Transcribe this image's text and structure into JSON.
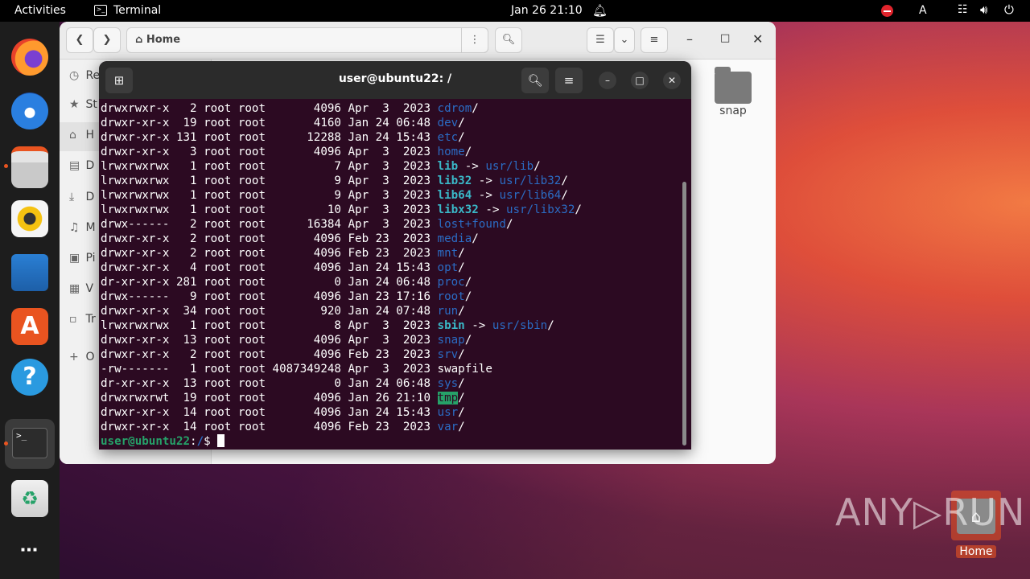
{
  "topbar": {
    "activities": "Activities",
    "app_name": "Terminal",
    "clock": "Jan 26  21:10",
    "keyboard": "A"
  },
  "dock": {
    "items": [
      "Firefox",
      "Thunderbird",
      "Files",
      "Rhythmbox",
      "LibreOffice Writer",
      "Ubuntu Software",
      "Help",
      "Terminal",
      "Trash",
      "Show Applications"
    ]
  },
  "files": {
    "location": "Home",
    "sidebar": [
      {
        "glyph": "◷",
        "label": "Re"
      },
      {
        "glyph": "★",
        "label": "St"
      },
      {
        "glyph": "⌂",
        "label": "H"
      },
      {
        "glyph": "▤",
        "label": "D"
      },
      {
        "glyph": "⤓",
        "label": "D"
      },
      {
        "glyph": "♫",
        "label": "M"
      },
      {
        "glyph": "▣",
        "label": "Pi"
      },
      {
        "glyph": "▦",
        "label": "V"
      },
      {
        "glyph": "▫",
        "label": "Tr"
      },
      {
        "glyph": "+",
        "label": "O"
      }
    ]
  },
  "terminal": {
    "title": "user@ubuntu22: /",
    "lines": [
      {
        "meta": "drwxrwxr-x   2 root root       4096 Apr  3  2023 ",
        "name": "cdrom",
        "kind": "dir",
        "tail": "/"
      },
      {
        "meta": "drwxr-xr-x  19 root root       4160 Jan 24 06:48 ",
        "name": "dev",
        "kind": "dir",
        "tail": "/"
      },
      {
        "meta": "drwxr-xr-x 131 root root      12288 Jan 24 15:43 ",
        "name": "etc",
        "kind": "dir",
        "tail": "/"
      },
      {
        "meta": "drwxr-xr-x   3 root root       4096 Apr  3  2023 ",
        "name": "home",
        "kind": "dir",
        "tail": "/"
      },
      {
        "meta": "lrwxrwxrwx   1 root root          7 Apr  3  2023 ",
        "name": "lib",
        "kind": "link",
        "arrow": " -> ",
        "target": "usr/lib",
        "tail": "/"
      },
      {
        "meta": "lrwxrwxrwx   1 root root          9 Apr  3  2023 ",
        "name": "lib32",
        "kind": "link",
        "arrow": " -> ",
        "target": "usr/lib32",
        "tail": "/"
      },
      {
        "meta": "lrwxrwxrwx   1 root root          9 Apr  3  2023 ",
        "name": "lib64",
        "kind": "link",
        "arrow": " -> ",
        "target": "usr/lib64",
        "tail": "/"
      },
      {
        "meta": "lrwxrwxrwx   1 root root         10 Apr  3  2023 ",
        "name": "libx32",
        "kind": "link",
        "arrow": " -> ",
        "target": "usr/libx32",
        "tail": "/"
      },
      {
        "meta": "drwx------   2 root root      16384 Apr  3  2023 ",
        "name": "lost+found",
        "kind": "dir",
        "tail": "/"
      },
      {
        "meta": "drwxr-xr-x   2 root root       4096 Feb 23  2023 ",
        "name": "media",
        "kind": "dir",
        "tail": "/"
      },
      {
        "meta": "drwxr-xr-x   2 root root       4096 Feb 23  2023 ",
        "name": "mnt",
        "kind": "dir",
        "tail": "/"
      },
      {
        "meta": "drwxr-xr-x   4 root root       4096 Jan 24 15:43 ",
        "name": "opt",
        "kind": "dir",
        "tail": "/"
      },
      {
        "meta": "dr-xr-xr-x 281 root root          0 Jan 24 06:48 ",
        "name": "proc",
        "kind": "dir",
        "tail": "/"
      },
      {
        "meta": "drwx------   9 root root       4096 Jan 23 17:16 ",
        "name": "root",
        "kind": "dir",
        "tail": "/"
      },
      {
        "meta": "drwxr-xr-x  34 root root        920 Jan 24 07:48 ",
        "name": "run",
        "kind": "dir",
        "tail": "/"
      },
      {
        "meta": "lrwxrwxrwx   1 root root          8 Apr  3  2023 ",
        "name": "sbin",
        "kind": "link",
        "arrow": " -> ",
        "target": "usr/sbin",
        "tail": "/"
      },
      {
        "meta": "drwxr-xr-x  13 root root       4096 Apr  3  2023 ",
        "name": "snap",
        "kind": "dir",
        "tail": "/"
      },
      {
        "meta": "drwxr-xr-x   2 root root       4096 Feb 23  2023 ",
        "name": "srv",
        "kind": "dir",
        "tail": "/"
      },
      {
        "meta": "-rw-------   1 root root 4087349248 Apr  3  2023 ",
        "name": "swapfile",
        "kind": "file",
        "tail": ""
      },
      {
        "meta": "dr-xr-xr-x  13 root root          0 Jan 24 06:48 ",
        "name": "sys",
        "kind": "dir",
        "tail": "/"
      },
      {
        "meta": "drwxrwxrwt  19 root root       4096 Jan 26 21:10 ",
        "name": "tmp",
        "kind": "sticky",
        "tail": "/"
      },
      {
        "meta": "drwxr-xr-x  14 root root       4096 Jan 24 15:43 ",
        "name": "usr",
        "kind": "dir",
        "tail": "/"
      },
      {
        "meta": "drwxr-xr-x  14 root root       4096 Feb 23  2023 ",
        "name": "var",
        "kind": "dir",
        "tail": "/"
      }
    ],
    "prompt_user": "user@ubuntu22",
    "prompt_sep": ":",
    "prompt_path": "/",
    "prompt_sym": "$ "
  },
  "desktop": {
    "snap_label": "snap",
    "home_label": "Home"
  },
  "watermark": "ANY▷RUN"
}
